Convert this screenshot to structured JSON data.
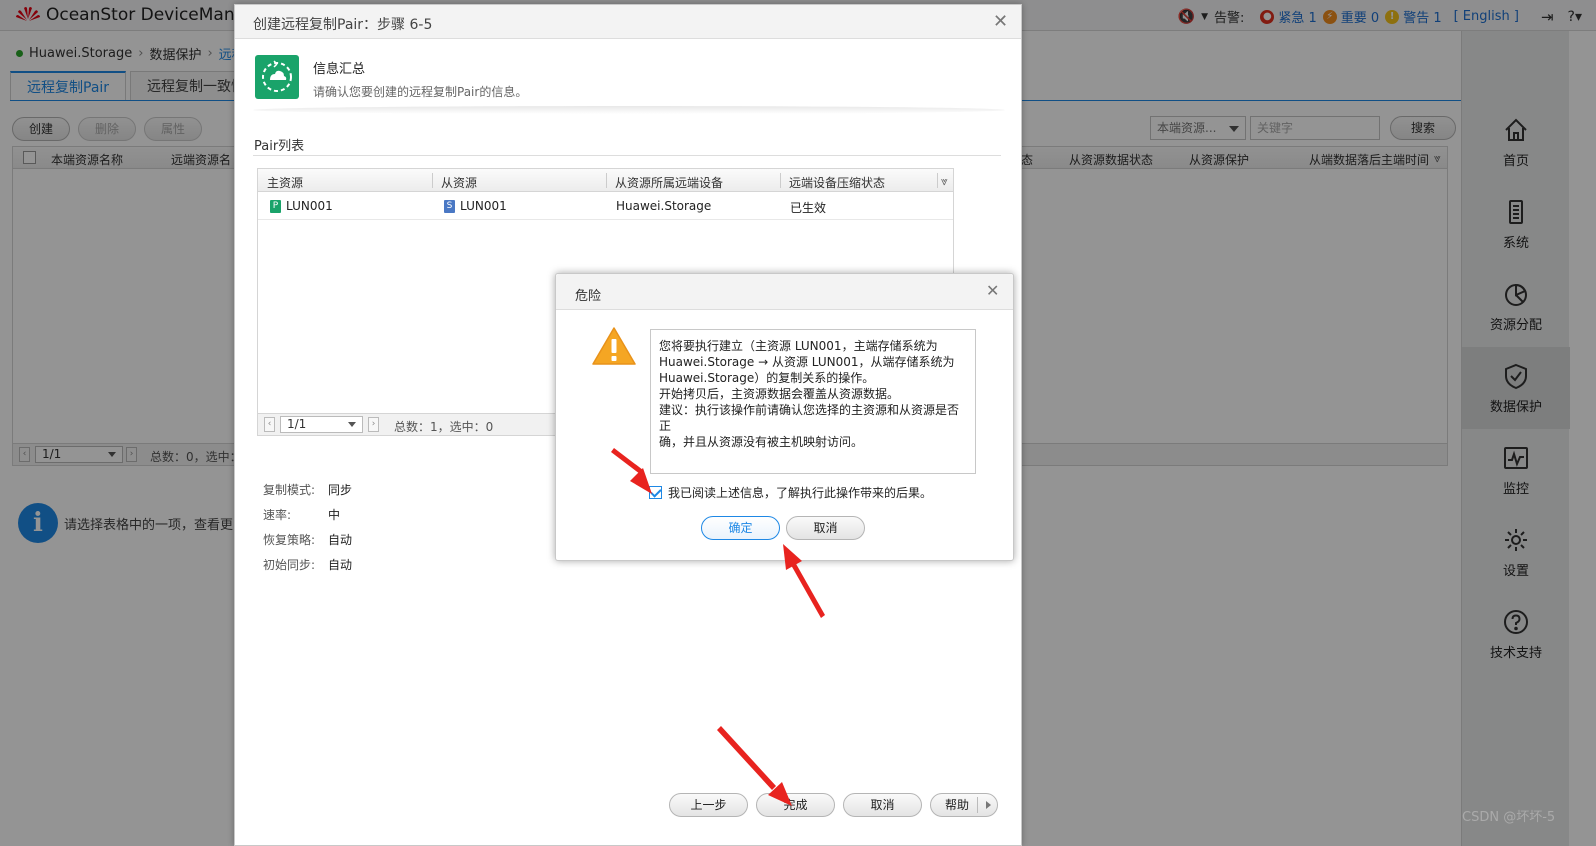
{
  "app": {
    "title": "OceanStor DeviceManag",
    "logo_text": "HUAWEI"
  },
  "alerts": {
    "label": "告警:",
    "critical": "紧急 1",
    "major": "重要 0",
    "warning": "警告 1",
    "language": "[ English ]"
  },
  "breadcrumb": {
    "device": "Huawei.Storage",
    "section": "数据保护",
    "current": "远程"
  },
  "tabs": [
    "远程复制Pair",
    "远程复制一致性"
  ],
  "toolbar": {
    "create": "创建",
    "delete": "删除",
    "properties": "属性"
  },
  "filter": {
    "scope": "本端资源...",
    "keyword_placeholder": "关键字",
    "search": "搜索"
  },
  "main_table": {
    "columns": [
      "本端资源名称",
      "远端资源名",
      "态",
      "从资源数据状态",
      "从资源保护",
      "从端数据落后主端时间"
    ],
    "page": "1/1",
    "summary": "总数：0，选中："
  },
  "hint": {
    "text": "请选择表格中的一项，查看更多"
  },
  "right_nav": [
    {
      "label": "首页",
      "icon": "home-icon"
    },
    {
      "label": "系统",
      "icon": "system-icon"
    },
    {
      "label": "资源分配",
      "icon": "resource-allocation-icon"
    },
    {
      "label": "数据保护",
      "icon": "data-protection-icon"
    },
    {
      "label": "监控",
      "icon": "monitor-icon"
    },
    {
      "label": "设置",
      "icon": "settings-icon"
    },
    {
      "label": "技术支持",
      "icon": "support-icon"
    }
  ],
  "wizard": {
    "title": "创建远程复制Pair：步骤 6-5",
    "step_title": "信息汇总",
    "step_desc": "请确认您要创建的远程复制Pair的信息。",
    "pair_list_title": "Pair列表",
    "pair_columns": [
      "主资源",
      "从资源",
      "从资源所属远端设备",
      "远端设备压缩状态"
    ],
    "pair_row": {
      "primary": "LUN001",
      "primary_badge": "P",
      "secondary": "LUN001",
      "secondary_badge": "S",
      "remote_device": "Huawei.Storage",
      "compression": "已生效"
    },
    "pair_page": "1/1",
    "pair_summary": "总数：1，选中：0",
    "properties": [
      {
        "label": "复制模式:",
        "value": "同步"
      },
      {
        "label": "速率:",
        "value": "中"
      },
      {
        "label": "恢复策略:",
        "value": "自动"
      },
      {
        "label": "初始同步:",
        "value": "自动"
      }
    ],
    "buttons": {
      "prev": "上一步",
      "finish": "完成",
      "cancel": "取消",
      "help": "帮助"
    }
  },
  "danger": {
    "title": "危险",
    "message": "您将要执行建立（主资源 LUN001，主端存储系统为\nHuawei.Storage → 从资源 LUN001，从端存储系统为\nHuawei.Storage）的复制关系的操作。\n开始拷贝后，主资源数据会覆盖从资源数据。\n建议：执行该操作前请确认您选择的主资源和从资源是否正\n确，并且从资源没有被主机映射访问。",
    "ack": "我已阅读上述信息，了解执行此操作带来的后果。",
    "ack_checked": true,
    "ok": "确定",
    "cancel": "取消"
  },
  "watermark": "CSDN @坏坏-5",
  "colors": {
    "accent": "#1e88e5",
    "brand_green": "#1aa36a",
    "annotation_red": "#e8231f",
    "warning_orange": "#f5a623"
  }
}
